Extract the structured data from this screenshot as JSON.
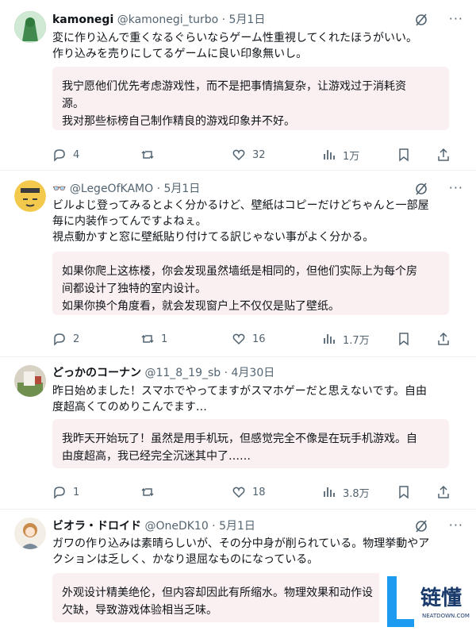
{
  "tweets": [
    {
      "name": "kamonegi",
      "handle": "@kamonegi_turbo · 5月1日",
      "text": "変に作り込んで重くなるぐらいならゲーム性重視してくれたほうがいい。\n作り込みを売りにしてるゲームに良い印象無いし。",
      "translation": "我宁愿他们优先考虑游戏性，而不是把事情搞复杂，让游戏过于消耗资\n源。\n我对那些标榜自己制作精良的游戏印象并不好。",
      "replies": "4",
      "retweets": "",
      "likes": "32",
      "views": "1万"
    },
    {
      "name": "👓",
      "handle": "@LegeOfKAMO · 5月1日",
      "text": "ビルよじ登ってみるとよく分かるけど、壁紙はコピーだけどちゃんと一部屋\n毎に内装作ってんですよねぇ。\n視点動かすと窓に壁紙貼り付けてる訳じゃない事がよく分かる。",
      "translation": "如果你爬上这栋楼，你会发现虽然墙纸是相同的，但他们实际上为每个房\n间都设计了独特的室内设计。\n如果你换个角度看，就会发现窗户上不仅仅是贴了壁纸。",
      "replies": "2",
      "retweets": "1",
      "likes": "16",
      "views": "1.7万"
    },
    {
      "name": "どっかのコーナン",
      "handle": "@11_8_19_sb · 4月30日",
      "text": "昨日始めました！スマホでやってますがスマホゲーだと思えないです。自由\n度超高くてのめりこんでます…",
      "translation": "我昨天开始玩了！虽然是用手机玩，但感觉完全不像是在玩手机游戏。自\n由度超高，我已经完全沉迷其中了……",
      "replies": "1",
      "retweets": "",
      "likes": "18",
      "views": "3.8万"
    },
    {
      "name": "ビオラ・ドロイド",
      "handle": "@OneDK10 · 5月1日",
      "text": "ガワの作り込みは素晴らしいが、その分中身が削られている。物理挙動やア\nクションは乏しく、かなり退屈なものになっている。",
      "translation": "外观设计精美绝伦，但内容却因此有所缩水。物理效果和动作设\n欠缺，导致游戏体验相当乏味。",
      "replies": "",
      "retweets": "",
      "likes": "",
      "views": ""
    }
  ],
  "more_label": "···",
  "colors": {
    "translation_bg": "#fbf0f1",
    "muted": "#536471",
    "text": "#0f1419"
  }
}
